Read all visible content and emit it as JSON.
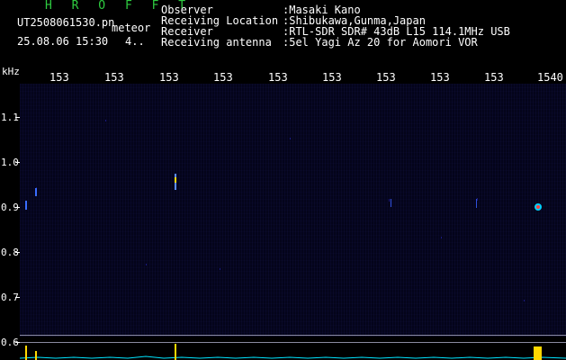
{
  "header": {
    "brand": "H R O F F T",
    "filename": "UT2508061530.pn",
    "detection_label": "meteor",
    "datetime": "25.08.06 15:30",
    "count": "4..",
    "info": [
      {
        "label": "Observer",
        "value": ":Masaki Kano"
      },
      {
        "label": "Receiving Location",
        "value": ":Shibukawa,Gunma,Japan"
      },
      {
        "label": "Receiver",
        "value": ":RTL-SDR SDR# 43dB L15 114.1MHz USB"
      },
      {
        "label": "Receiving antenna",
        "value": ":5el Yagi Az 20 for Aomori VOR"
      }
    ]
  },
  "axes": {
    "y_unit": "kHz",
    "y_ticks": [
      "1.1",
      "1.0",
      "0.9",
      "0.8",
      "0.7",
      "0.6"
    ],
    "x_ticks": [
      "153",
      "153",
      "153",
      "153",
      "153",
      "153",
      "153",
      "153",
      "153",
      "1540"
    ]
  },
  "colors": {
    "background": "#000000",
    "spectrogram": "#04041a",
    "brand_green": "#2ecc40",
    "trace_cyan": "#00e5ff",
    "signal_yellow": "#ffd800"
  }
}
